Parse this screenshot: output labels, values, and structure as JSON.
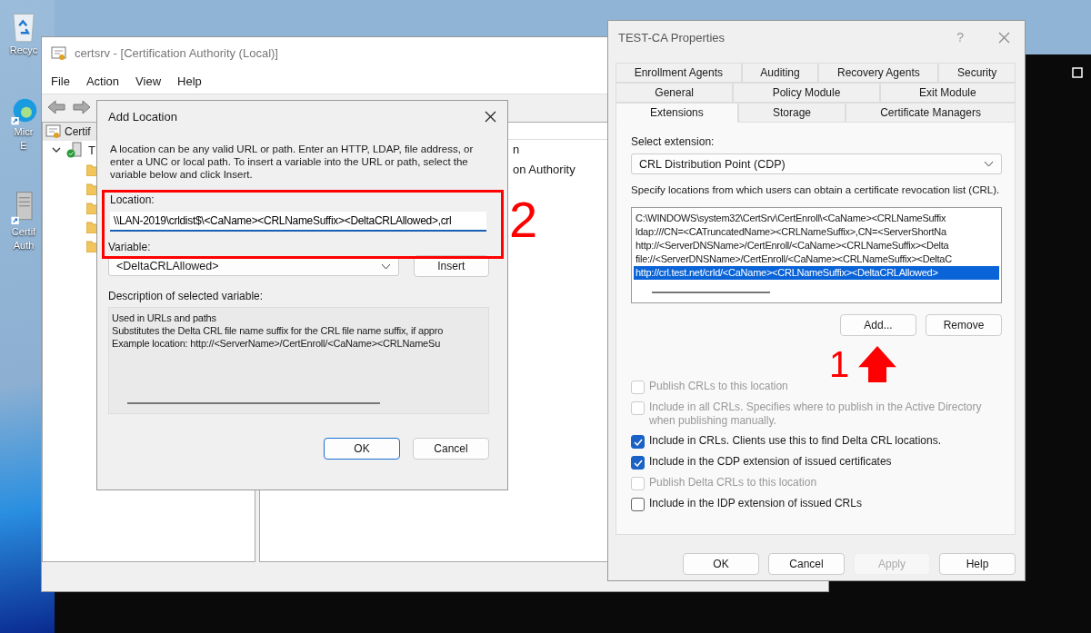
{
  "desktop": {
    "icons": [
      {
        "kind": "recycle",
        "lines": [
          "Recyc"
        ]
      },
      {
        "kind": "edge",
        "lines": [
          "Micr",
          "E"
        ]
      },
      {
        "kind": "cert",
        "lines": [
          "Certif",
          "Auth"
        ]
      }
    ]
  },
  "mmc": {
    "title": "certsrv - [Certification Authority (Local)]",
    "menu": [
      "File",
      "Action",
      "View",
      "Help"
    ],
    "tree": {
      "label": "Certif",
      "children": [
        {
          "label": "T",
          "expanded": true
        }
      ]
    },
    "content_lines": [
      "n",
      "on Authority"
    ]
  },
  "add_location": {
    "title": "Add Location",
    "intro": "A location can be any valid URL or path. Enter an HTTP, LDAP, file address, or enter a UNC or local path. To insert a variable into the URL or path, select the variable below and click Insert.",
    "location_label": "Location:",
    "location_value": "\\\\LAN-2019\\crldist$\\<CaName><CRLNameSuffix><DeltaCRLAllowed>,crl",
    "variable_label": "Variable:",
    "variable_value": "<DeltaCRLAllowed>",
    "insert_button": "Insert",
    "description_label": "Description of selected variable:",
    "description_lines": [
      "Used in URLs and paths",
      "Substitutes the Delta CRL file name suffix for the CRL file name suffix, if appro",
      "Example location: http://<ServerName>/CertEnroll/<CaName><CRLNameSu"
    ],
    "buttons": [
      {
        "label": "OK",
        "default": true
      },
      {
        "label": "Cancel",
        "default": false
      }
    ]
  },
  "properties": {
    "title": "TEST-CA Properties",
    "help_glyph": "?",
    "tab_rows": [
      [
        {
          "label": "Enrollment Agents",
          "selected": false
        },
        {
          "label": "Auditing",
          "selected": false
        },
        {
          "label": "Recovery Agents",
          "selected": false
        },
        {
          "label": "Security",
          "selected": false
        }
      ],
      [
        {
          "label": "General",
          "selected": false
        },
        {
          "label": "Policy Module",
          "selected": false
        },
        {
          "label": "Exit Module",
          "selected": false
        }
      ],
      [
        {
          "label": "Extensions",
          "selected": true
        },
        {
          "label": "Storage",
          "selected": false
        },
        {
          "label": "Certificate Managers",
          "selected": false
        }
      ]
    ],
    "select_label": "Select extension:",
    "extension_value": "CRL Distribution Point (CDP)",
    "locations_hint": "Specify locations from which users can obtain a certificate revocation list (CRL).",
    "locations": [
      {
        "text": "C:\\WINDOWS\\system32\\CertSrv\\CertEnroll\\<CaName><CRLNameSuffix",
        "selected": false
      },
      {
        "text": "ldap:///CN=<CATruncatedName><CRLNameSuffix>,CN=<ServerShortNa",
        "selected": false
      },
      {
        "text": "http://<ServerDNSName>/CertEnroll/<CaName><CRLNameSuffix><Delta",
        "selected": false
      },
      {
        "text": "file://<ServerDNSName>/CertEnroll/<CaName><CRLNameSuffix><DeltaC",
        "selected": false
      },
      {
        "text": "http://crl.test.net/crld/<CaName><CRLNameSuffix><DeltaCRLAllowed>",
        "selected": true
      }
    ],
    "list_buttons": [
      {
        "label": "Add...",
        "disabled": false
      },
      {
        "label": "Remove",
        "disabled": false
      }
    ],
    "options": [
      {
        "label": "Publish CRLs to this location",
        "checked": false,
        "disabled": true
      },
      {
        "label": "Include in all CRLs. Specifies where to publish in the Active Directory when publishing manually.",
        "checked": false,
        "disabled": true
      },
      {
        "label": "Include in CRLs. Clients use this to find Delta CRL locations.",
        "checked": true,
        "disabled": false
      },
      {
        "label": "Include in the CDP extension of issued certificates",
        "checked": true,
        "disabled": false
      },
      {
        "label": "Publish Delta CRLs to this location",
        "checked": false,
        "disabled": true
      },
      {
        "label": "Include in the IDP extension of issued CRLs",
        "checked": false,
        "disabled": false
      }
    ],
    "buttons": [
      {
        "label": "OK",
        "disabled": false
      },
      {
        "label": "Cancel",
        "disabled": false
      },
      {
        "label": "Apply",
        "disabled": true
      },
      {
        "label": "Help",
        "disabled": false
      }
    ]
  },
  "annotations": {
    "step_1": "1",
    "step_2": "2"
  }
}
